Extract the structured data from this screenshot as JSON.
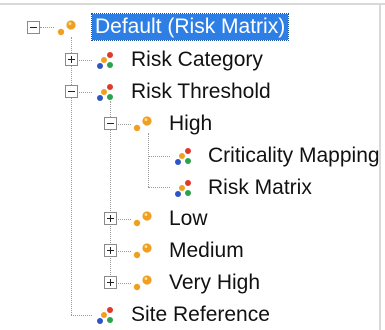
{
  "tree": {
    "root": {
      "label": "Default (Risk Matrix)",
      "selected": true,
      "icon": "folder-dots-icon"
    },
    "items": [
      {
        "label": "Risk Category",
        "icon": "tri-dots-icon"
      },
      {
        "label": "Risk Threshold",
        "icon": "tri-dots-icon"
      },
      {
        "label": "High",
        "icon": "folder-dots-icon"
      },
      {
        "label": "Criticality Mapping",
        "icon": "tri-dots-icon"
      },
      {
        "label": "Risk Matrix",
        "icon": "tri-dots-icon"
      },
      {
        "label": "Low",
        "icon": "folder-dots-icon"
      },
      {
        "label": "Medium",
        "icon": "folder-dots-icon"
      },
      {
        "label": "Very High",
        "icon": "folder-dots-icon"
      },
      {
        "label": "Site Reference",
        "icon": "tri-dots-icon"
      }
    ]
  },
  "colors": {
    "selection": "#2d7fe6",
    "dot_orange": "#f0a020",
    "dot_red": "#e23a2a",
    "dot_green": "#2aa34a",
    "dot_blue": "#2c56c8"
  }
}
